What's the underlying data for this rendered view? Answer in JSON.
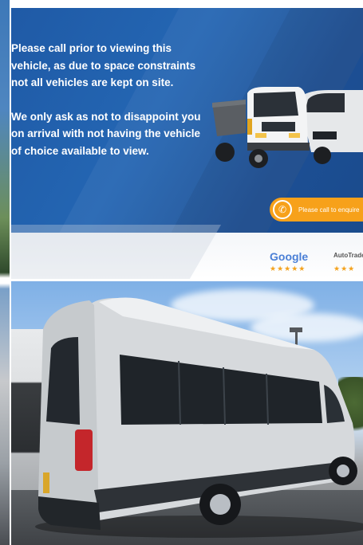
{
  "banner": {
    "paragraph_1": "Please call prior to viewing this vehicle, as due to space constraints not all vehicles are kept on site.",
    "paragraph_2": "We only ask as not to disappoint you on arrival with not having the vehicle of choice available to view.",
    "cta_label": "Please call to enquire",
    "colors": {
      "background": "#1f5aa6",
      "cta": "#f7a11a",
      "stars": "#f4a21d"
    }
  },
  "reviews": {
    "google_label": "Google",
    "google_stars": "★★★★★",
    "autotrader_label": "AutoTrader",
    "autotrader_stars": "★★★"
  },
  "photo": {
    "subject": "silver-minibus"
  }
}
